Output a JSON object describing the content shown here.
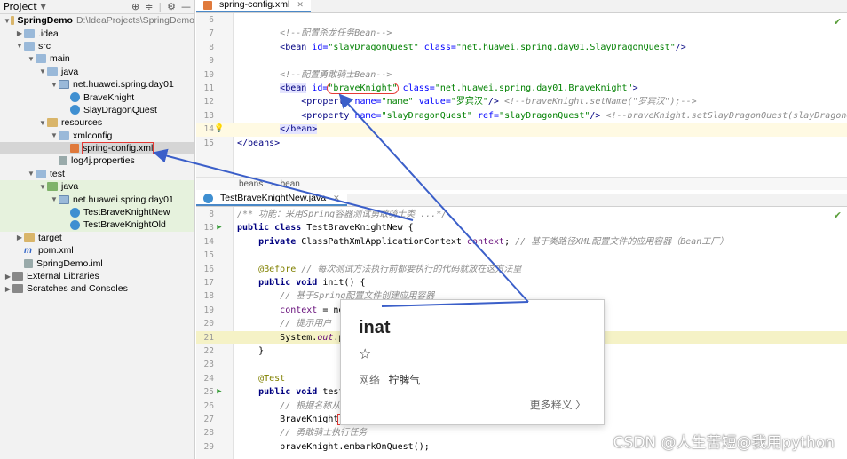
{
  "project": {
    "header": "Project",
    "tree": [
      {
        "label": "SpringDemo",
        "hint": "D:\\IdeaProjects\\SpringDemo",
        "depth": 0,
        "icon": "folder-y",
        "arrow": "▼",
        "bold": true
      },
      {
        "label": ".idea",
        "depth": 1,
        "icon": "folder",
        "arrow": "▶"
      },
      {
        "label": "src",
        "depth": 1,
        "icon": "folder",
        "arrow": "▼"
      },
      {
        "label": "main",
        "depth": 2,
        "icon": "folder",
        "arrow": "▼"
      },
      {
        "label": "java",
        "depth": 3,
        "icon": "folder",
        "arrow": "▼"
      },
      {
        "label": "net.huawei.spring.day01",
        "depth": 4,
        "icon": "folder-pkg",
        "arrow": "▼"
      },
      {
        "label": "BraveKnight",
        "depth": 5,
        "icon": "cls"
      },
      {
        "label": "SlayDragonQuest",
        "depth": 5,
        "icon": "cls"
      },
      {
        "label": "resources",
        "depth": 3,
        "icon": "folder-y",
        "arrow": "▼"
      },
      {
        "label": "xmlconfig",
        "depth": 4,
        "icon": "folder",
        "arrow": "▼"
      },
      {
        "label": "spring-config.xml",
        "depth": 5,
        "icon": "xml",
        "selected": true,
        "redbox": true
      },
      {
        "label": "log4j.properties",
        "depth": 4,
        "icon": "prop"
      },
      {
        "label": "test",
        "depth": 2,
        "icon": "folder",
        "arrow": "▼"
      },
      {
        "label": "java",
        "depth": 3,
        "icon": "folder-g",
        "arrow": "▼",
        "green": true
      },
      {
        "label": "net.huawei.spring.day01",
        "depth": 4,
        "icon": "folder-pkg",
        "arrow": "▼",
        "green": true
      },
      {
        "label": "TestBraveKnightNew",
        "depth": 5,
        "icon": "cls",
        "green": true
      },
      {
        "label": "TestBraveKnightOld",
        "depth": 5,
        "icon": "cls",
        "green": true
      },
      {
        "label": "target",
        "depth": 1,
        "icon": "folder-y",
        "arrow": "▶"
      },
      {
        "label": "pom.xml",
        "depth": 1,
        "icon": "m"
      },
      {
        "label": "SpringDemo.iml",
        "depth": 1,
        "icon": "prop"
      },
      {
        "label": "External Libraries",
        "depth": 0,
        "icon": "lib",
        "arrow": "▶"
      },
      {
        "label": "Scratches and Consoles",
        "depth": 0,
        "icon": "lib",
        "arrow": "▶"
      }
    ]
  },
  "xml_tab": {
    "label": "spring-config.xml"
  },
  "java_tab": {
    "label": "TestBraveKnightNew.java"
  },
  "breadcrumb": {
    "a": "beans",
    "b": "bean"
  },
  "xml_lines": [
    {
      "n": "6"
    },
    {
      "n": "7",
      "c": "        <!--配置杀龙任务Bean-->"
    },
    {
      "n": "8"
    },
    {
      "n": "9"
    },
    {
      "n": "10",
      "c": "        <!--配置勇敢骑士Bean-->"
    },
    {
      "n": "11"
    },
    {
      "n": "12"
    },
    {
      "n": "13"
    },
    {
      "n": "14"
    },
    {
      "n": "15"
    }
  ],
  "xml_text": {
    "l8_a": "<bean ",
    "l8_b": "id=",
    "l8_c": "\"slayDragonQuest\"",
    "l8_d": " class=",
    "l8_e": "\"net.huawei.spring.day01.SlayDragonQuest\"",
    "l8_f": "/>",
    "l11_a": "<bean",
    "l11_b": " id=",
    "l11_c": "\"braveKnight\"",
    "l11_d": " class=",
    "l11_e": "\"net.huawei.spring.day01.BraveKnight\"",
    "l11_f": ">",
    "l12_a": "<property ",
    "l12_b": "name=",
    "l12_c": "\"name\"",
    "l12_d": " value=",
    "l12_e": "\"罗宾汉\"",
    "l12_f": "/> ",
    "l12_g": "<!--braveKnight.setName(\"罗宾汉\");-->",
    "l13_a": "<property ",
    "l13_b": "name=",
    "l13_c": "\"slayDragonQuest\"",
    "l13_d": " ref=",
    "l13_e": "\"slayDragonQuest\"",
    "l13_f": "/> ",
    "l13_g": "<!--braveKnight.setSlayDragonQuest(slayDragonQuest);-->",
    "l14": "</bean>",
    "l15": "</beans>"
  },
  "java_text": {
    "l8": "/** 功能：采用Spring容器测试勇敢骑士类 ...*/",
    "l13_a": "public class ",
    "l13_b": "TestBraveKnightNew {",
    "l14_a": "private ",
    "l14_b": "ClassPathXmlApplicationContext ",
    "l14_c": "context",
    "l14_d": "; ",
    "l14_e": "// 基于类路径XML配置文件的应用容器（Bean工厂）",
    "l16_a": "@Before",
    "l16_b": " // 每次测试方法执行前都要执行的代码就放在这方法里",
    "l17_a": "public void ",
    "l17_b": "init() {",
    "l18": "// 基于Spring配置文件创建应用容器",
    "l19_a": "context",
    "l19_b": " = ne",
    "l19_c": "nfig/spring-config.xml\"",
    "l19_d": ");",
    "l20": "// 提示用户",
    "l21_a": "System.",
    "l21_b": "out",
    "l21_c": ".p",
    "l22": "}",
    "l24": "@Test",
    "l25_a": "public void ",
    "l25_b": "test",
    "l26": "// 根据名称从",
    "l27_a": "BraveKnight",
    "l27_b": "raveKnight\"",
    "l27_c": ");",
    "l28": "// 勇敢骑士执行任务",
    "l29": "braveKnight.embarkOnQuest();"
  },
  "java_line_numbers": [
    "8",
    "13",
    "14",
    "15",
    "16",
    "17",
    "18",
    "19",
    "20",
    "21",
    "22",
    "23",
    "24",
    "25",
    "26",
    "27",
    "28",
    "29"
  ],
  "popup": {
    "word": "inat",
    "star": "☆",
    "label": "网络",
    "meaning": "拧脾气",
    "more": "更多释义 〉"
  },
  "watermark": "CSDN @人生苦短@我用python",
  "colors": {
    "annotation_arrow": "#3b5fc9",
    "highlight_box": "#e53935"
  }
}
